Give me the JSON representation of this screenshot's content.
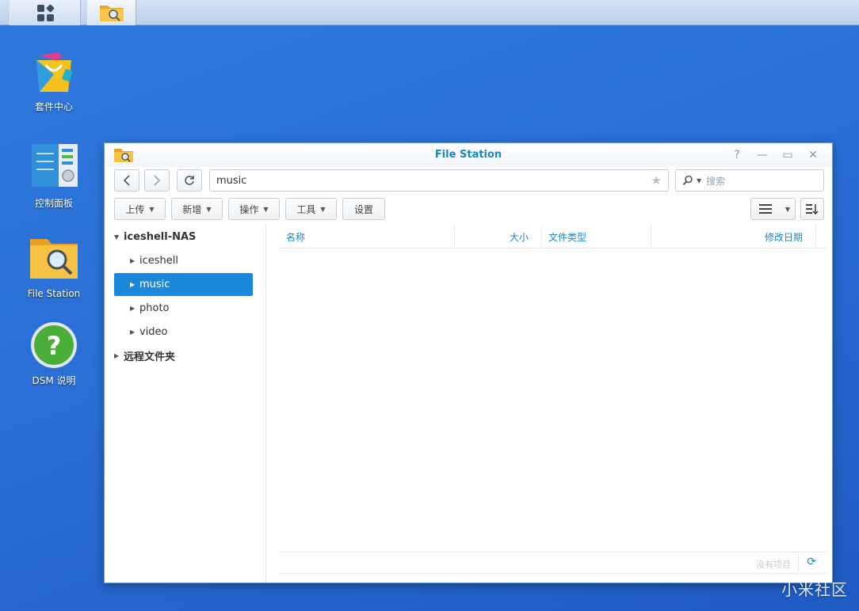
{
  "taskbar": {
    "main_menu_icon": "grid-icon",
    "pinned_app_icon": "file-station-folder-icon"
  },
  "desktop": {
    "icons": [
      {
        "label": "套件中心",
        "icon": "package-center-icon"
      },
      {
        "label": "控制面板",
        "icon": "control-panel-icon"
      },
      {
        "label": "File Station",
        "icon": "file-station-folder-icon"
      },
      {
        "label": "DSM 说明",
        "icon": "help-icon"
      }
    ]
  },
  "window": {
    "title": "File Station",
    "controls": {
      "help": "?",
      "minimize": "—",
      "maximize": "▭",
      "close": "✕"
    },
    "address": {
      "value": "music"
    },
    "search": {
      "placeholder": "搜索"
    },
    "toolbar": {
      "upload": "上传",
      "create": "新增",
      "action": "操作",
      "tools": "工具",
      "settings": "设置"
    },
    "tree": {
      "root": "iceshell-NAS",
      "items": [
        "iceshell",
        "music",
        "photo",
        "video"
      ],
      "selected": "music",
      "remote": "远程文件夹"
    },
    "columns": {
      "name": "名称",
      "size": "大小",
      "type": "文件类型",
      "modified": "修改日期"
    },
    "footer": {
      "status": "没有项目"
    }
  },
  "watermark": "小米社区",
  "colors": {
    "accent": "#1a86c7",
    "selected": "#1a89db",
    "desktop": "#2a6fd6"
  }
}
